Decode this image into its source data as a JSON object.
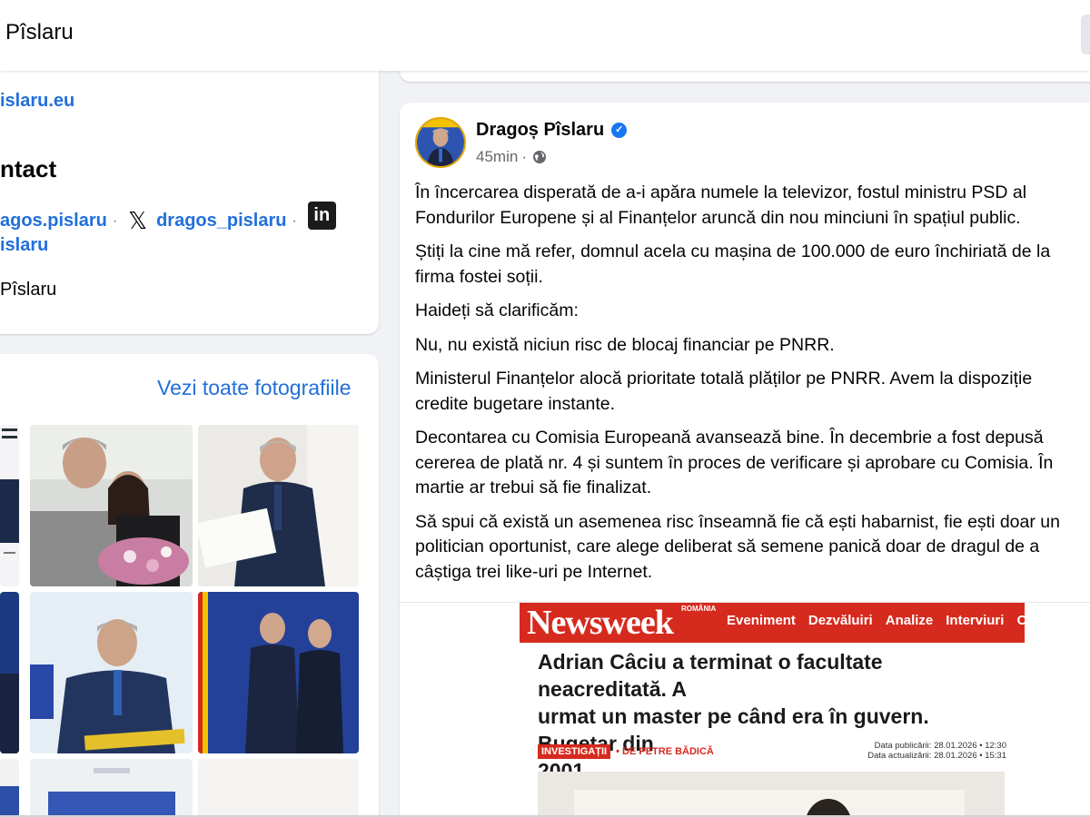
{
  "header": {
    "title": "Pîslaru"
  },
  "intro": {
    "website": "islaru.eu",
    "contact_heading": "ntact",
    "facebook_handle": "agos.pislaru",
    "x_handle": "dragos_pislaru",
    "separator": "·",
    "linkedin_handle": "islaru",
    "name": "Pîslaru"
  },
  "photos": {
    "see_all_label": "Vezi toate fotografiile"
  },
  "post": {
    "author": "Dragoș Pîslaru",
    "time": "45min",
    "separator": "·",
    "paragraphs": [
      [
        "În încercarea disperată de a-i apăra numele la televizor, fostul ministru PSD al",
        "Fondurilor Europene și al Finanțelor aruncă din nou minciuni în spațiul public."
      ],
      [
        "Știți la cine mă refer, domnul acela cu mașina de 100.000 de euro închiriată de la",
        "firma fostei soții."
      ],
      [
        "Haideți să clarificăm:"
      ],
      [
        "Nu, nu există niciun risc de blocaj financiar pe PNRR."
      ],
      [
        "Ministerul Finanțelor alocă prioritate totală plăților pe PNRR. Avem la dispoziție",
        "credite bugetare instante."
      ],
      [
        "Decontarea cu Comisia Europeană avansează bine. În decembrie a fost depusă",
        "cererea de plată nr. 4 și suntem în proces de verificare și aprobare cu Comisia. În",
        "martie ar trebui să fie finalizat."
      ],
      [
        "Să spui că există un asemenea risc înseamnă fie că ești habarnist, fie ești doar un",
        "politician oportunist, care alege deliberat să semene panică doar de dragul de a",
        "câștiga trei like-uri pe Internet."
      ]
    ]
  },
  "article": {
    "logo": "Newsweek",
    "edition": "ROMÂNIA",
    "nav": [
      "Eveniment",
      "Dezvăluiri",
      "Analize",
      "Interviuri",
      "Opi"
    ],
    "headline_lines": [
      "Adrian Câciu a terminat o facultate neacreditată. A",
      "urmat un master pe când era în guvern. Bugetar din",
      "2001"
    ],
    "tag": "INVESTIGAȚII",
    "byline": "• DE PETRE BĂDICĂ",
    "published": "Data publicării: 28.01.2026 • 12:30",
    "updated": "Data actualizării: 28.01.2026 • 15:31"
  },
  "colors": {
    "link": "#216fdb",
    "verified": "#1877f2",
    "newsweek_red": "#d62a1e"
  }
}
